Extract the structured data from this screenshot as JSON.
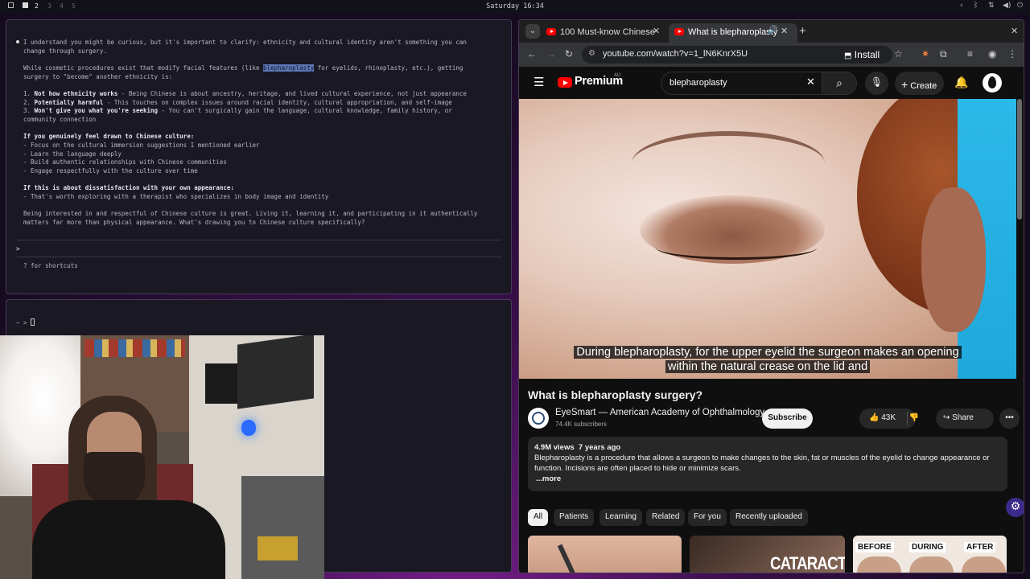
{
  "topbar": {
    "workspaces": [
      "2",
      "3",
      "4",
      "5"
    ],
    "clock": "Saturday 16:34"
  },
  "terminal1": {
    "lines": [
      "I understand you might be curious, but it's important to clarify: ethnicity and cultural identity aren't something you can",
      "change through surgery.",
      "While cosmetic procedures exist that modify facial features (like ",
      "blepharoplasty",
      " for eyelids, rhinoplasty, etc.), getting",
      "surgery to \"become\" another ethnicity is:",
      "1. ",
      "Not how ethnicity works",
      " - Being Chinese is about ancestry, heritage, and lived cultural experience, not just appearance",
      "2. ",
      "Potentially harmful",
      " - This touches on complex issues around racial identity, cultural appropriation, and self-image",
      "3. ",
      "Won't give you what you're seeking",
      " - You can't surgically gain the language, cultural knowledge, family history, or",
      "community connection",
      "If you genuinely feel drawn to Chinese culture:",
      "- Focus on the cultural immersion suggestions I mentioned earlier",
      "- Learn the language deeply",
      "- Build authentic relationships with Chinese communities",
      "- Engage respectfully with the culture over time",
      "If this is about dissatisfaction with your own appearance:",
      "- That's worth exploring with a therapist who specializes in body image and identity",
      "Being interested in and respectful of Chinese culture is great. Living it, learning it, and participating in it authentically",
      "matters far more than physical appearance. What's drawing you to Chinese culture specifically?"
    ],
    "prompt": ">",
    "shortcuts_hint": "? for shortcuts"
  },
  "terminal2": {
    "prompt": "~ > "
  },
  "browser": {
    "tabs": [
      {
        "title": "100 Must-know Chinese"
      },
      {
        "title": "What is blepharoplasty"
      }
    ],
    "url": "youtube.com/watch?v=1_lN6KnrX5U",
    "install_label": "Install"
  },
  "youtube": {
    "brand": "Premium",
    "region": "AU",
    "search_value": "blepharoplasty",
    "create_label": "Create",
    "caption_line1": "During blepharoplasty, for the upper eyelid the surgeon makes an opening",
    "caption_line2": "within the natural crease on the lid and",
    "video_title": "What is blepharoplasty surgery?",
    "channel_name": "EyeSmart — American Academy of Ophthalmology",
    "subscribers": "74.4K subscribers",
    "subscribe_label": "Subscribe",
    "likes": "43K",
    "share_label": "Share",
    "views": "4.9M views",
    "age": "7 years ago",
    "description_1": "Blepharoplasty is a procedure that allows a surgeon to make changes to the skin, fat or muscles of the eyelid to change appearance or",
    "description_2": "function. Incisions are often placed to hide or minimize scars.",
    "more_label": "...more",
    "chips": [
      "All",
      "Patients",
      "Learning",
      "Related",
      "For you",
      "Recently uploaded"
    ],
    "thumb_cataract": "CATARACT",
    "thumb_labels": [
      "BEFORE",
      "DURING",
      "AFTER"
    ]
  },
  "colors": {
    "youtube_red": "#ff0000",
    "terminal_bg": "#1a1823",
    "highlight": "#5b78b8"
  }
}
